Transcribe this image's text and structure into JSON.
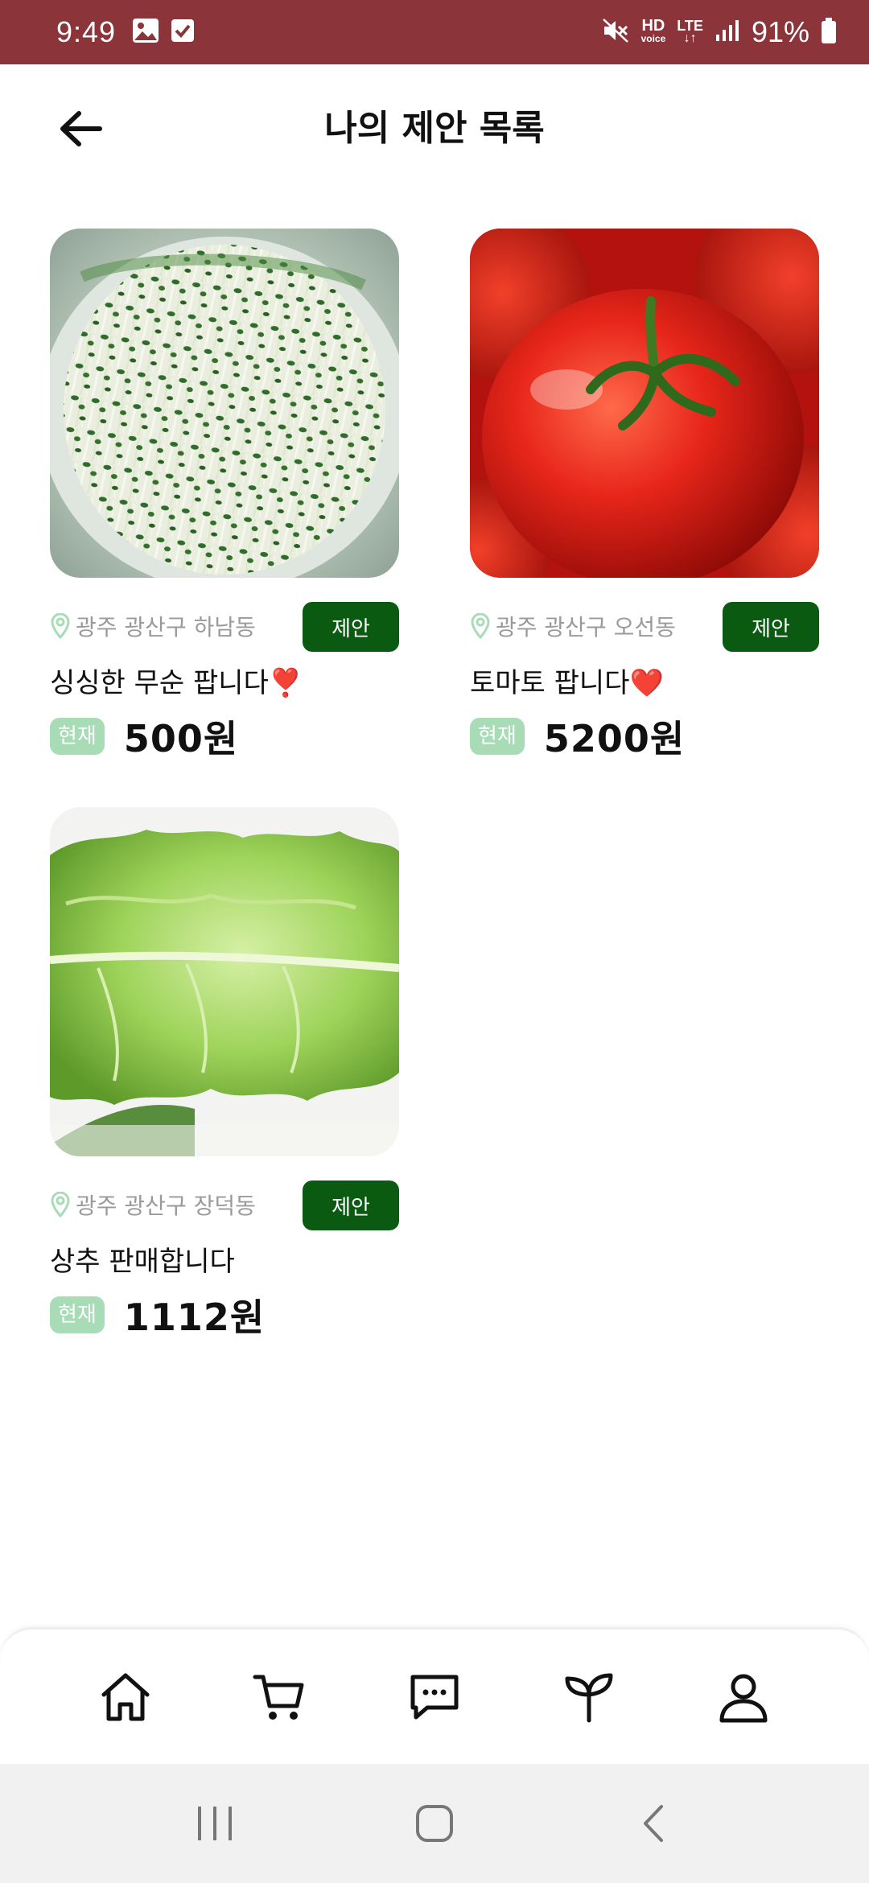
{
  "status_bar": {
    "time": "9:49",
    "icons_left": [
      "image-icon",
      "checkbox-icon"
    ],
    "hd_top": "HD",
    "hd_bottom": "voice",
    "lte_top": "LTE",
    "battery": "91%",
    "bg_color": "#8b3439"
  },
  "header": {
    "title": "나의 제안 목록"
  },
  "products": [
    {
      "location": "광주 광산구 하남동",
      "button": "제안",
      "title": "싱싱한 무순 팝니다❣️",
      "badge": "현재",
      "price": "500원",
      "image": "sprouts-photo"
    },
    {
      "location": "광주 광산구 오선동",
      "button": "제안",
      "title": "토마토 팝니다❤️",
      "badge": "현재",
      "price": "5200원",
      "image": "tomato-photo"
    },
    {
      "location": "광주 광산구 장덕동",
      "button": "제안",
      "title": "상추 판매합니다",
      "badge": "현재",
      "price": "1112원",
      "image": "lettuce-photo"
    }
  ],
  "colors": {
    "accent_green": "#0b5a12",
    "badge_green": "#a8dcb7"
  },
  "bottom_nav": [
    "home-icon",
    "cart-icon",
    "chat-icon",
    "sprout-icon",
    "profile-icon"
  ],
  "system_nav": [
    "recents-icon",
    "home-circle-icon",
    "back-chevron-icon"
  ]
}
